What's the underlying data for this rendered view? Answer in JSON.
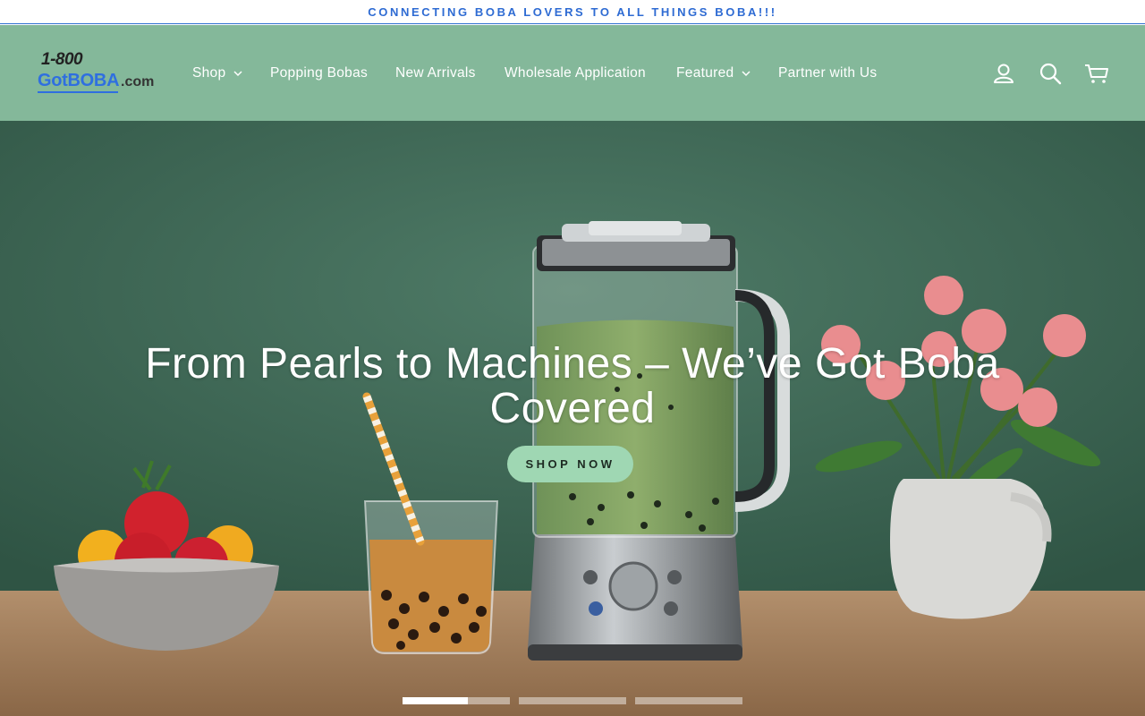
{
  "announcement": {
    "text": "CONNECTING BOBA LOVERS TO ALL THINGS BOBA!!!"
  },
  "logo": {
    "line1": "1-800",
    "line2": "GotBOBA",
    "line3": ".com"
  },
  "nav": {
    "items": [
      {
        "label": "Shop",
        "has_dropdown": true
      },
      {
        "label": "Popping Bobas",
        "has_dropdown": false
      },
      {
        "label": "New Arrivals",
        "has_dropdown": false
      },
      {
        "label": "Wholesale Application",
        "has_dropdown": false
      },
      {
        "label": "Featured",
        "has_dropdown": true
      },
      {
        "label": "Partner with Us",
        "has_dropdown": false
      }
    ]
  },
  "header_icons": [
    "account-icon",
    "search-icon",
    "cart-icon"
  ],
  "hero": {
    "title": "From Pearls to Machines – We’ve Got Boba Covered",
    "cta_label": "SHOP NOW"
  },
  "slider": {
    "slide_count": 3,
    "active_index": 0
  },
  "colors": {
    "header_bg": "#84b89a",
    "announcement_text": "#2e6bd3",
    "cta_bg": "#9fd7b3",
    "hero_wall": "#3f6656"
  }
}
